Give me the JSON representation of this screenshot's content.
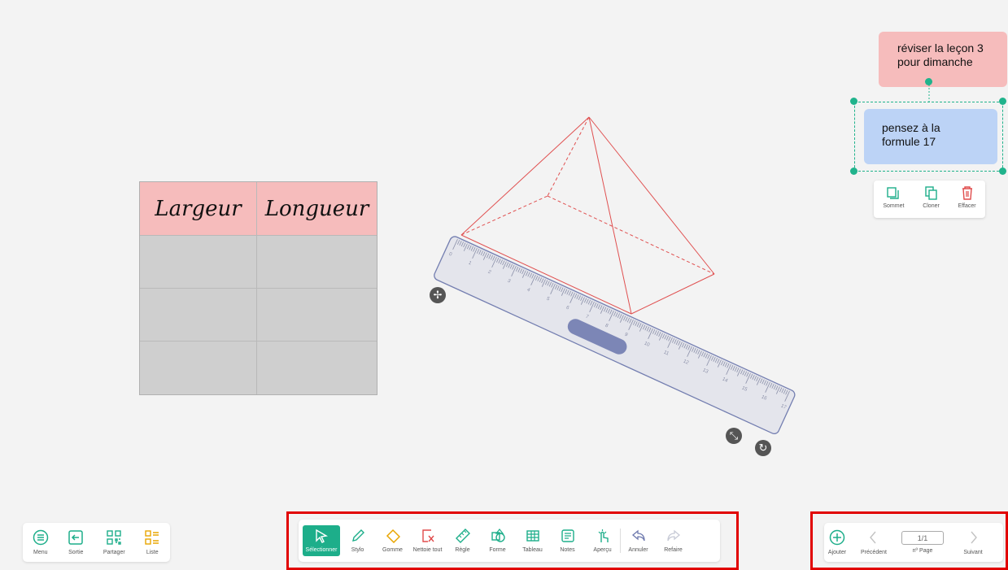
{
  "table": {
    "headers": [
      "Largeur",
      "Longueur"
    ],
    "rows": [
      [
        "",
        ""
      ],
      [
        "",
        ""
      ],
      [
        "",
        ""
      ]
    ]
  },
  "notes": [
    {
      "text_line1": "réviser la leçon 3",
      "text_line2": "pour dimanche"
    },
    {
      "text_line1": "pensez à la",
      "text_line2": "formule 17"
    }
  ],
  "note_actions": {
    "sommet": "Sommet",
    "cloner": "Cloner",
    "effacer": "Effacer"
  },
  "ruler": {
    "ticks": [
      "0",
      "1",
      "2",
      "3",
      "4",
      "5",
      "6",
      "7",
      "8",
      "9",
      "10",
      "11",
      "12",
      "13",
      "14",
      "15",
      "16",
      "17"
    ]
  },
  "left_toolbar": {
    "menu": "Menu",
    "sortie": "Sortie",
    "partager": "Partager",
    "liste": "Liste"
  },
  "main_toolbar": {
    "selectionner": "Sélectionner",
    "stylo": "Stylo",
    "gomme": "Gomme",
    "nettoie_tout": "Nettoie tout",
    "regle": "Règle",
    "forme": "Forme",
    "tableau": "Tableau",
    "notes": "Notes",
    "apercu": "Aperçu",
    "annuler": "Annuler",
    "refaire": "Refaire"
  },
  "page_nav": {
    "ajouter": "Ajouter",
    "precedent": "Précédent",
    "page_value": "1/1",
    "page_label": "nº Page",
    "suivant": "Suivant"
  },
  "colors": {
    "accent": "#1dae8a",
    "note_pink": "#f6bcbc",
    "note_blue": "#bcd3f6",
    "highlight_frame": "#e10000",
    "pyramid": "#e05050"
  }
}
